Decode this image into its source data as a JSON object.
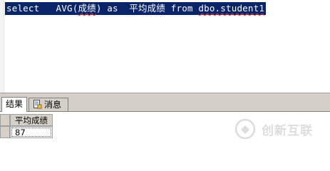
{
  "editor": {
    "query_segments": [
      {
        "text": "select   AVG(",
        "error": false
      },
      {
        "text": "成绩",
        "error": true
      },
      {
        "text": ") as  ",
        "error": false
      },
      {
        "text": "平均成绩",
        "error": false
      },
      {
        "text": " from ",
        "error": false
      },
      {
        "text": "dbo.student1",
        "error": true
      }
    ]
  },
  "tabs": {
    "results_label": "结果",
    "messages_label": "消息"
  },
  "grid": {
    "column_header": "平均成绩",
    "rows": [
      {
        "value": "87"
      }
    ]
  },
  "colors": {
    "selection": "#0a246a",
    "error_underline": "#e8402a",
    "chrome": "#d4d0c8"
  },
  "watermark": {
    "text": "创新互联"
  }
}
